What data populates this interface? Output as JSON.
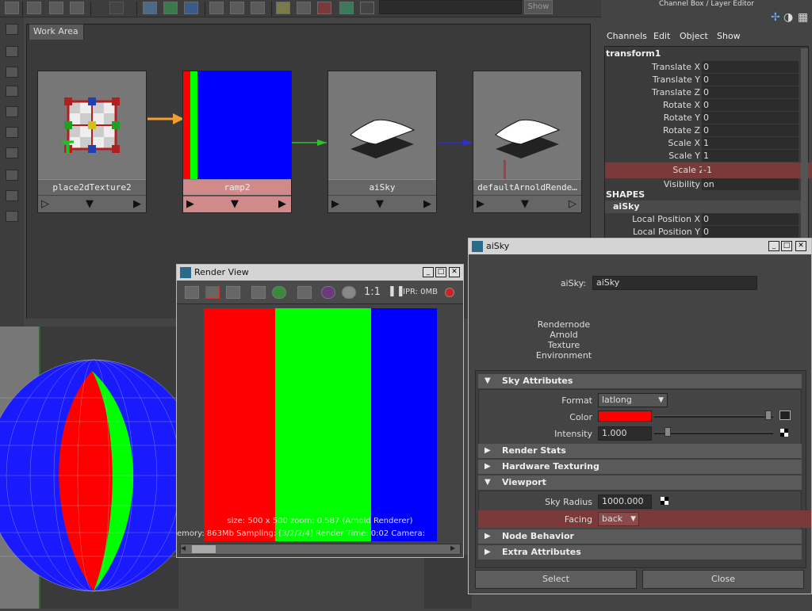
{
  "toolbar": {
    "show_label": "Show"
  },
  "workarea": {
    "tab_label": "Work Area"
  },
  "nodes": [
    {
      "label": "place2dTexture2"
    },
    {
      "label": "ramp2"
    },
    {
      "label": "aiSky"
    },
    {
      "label": "defaultArnoldRende…"
    }
  ],
  "channel_box": {
    "title": "Channel Box / Layer Editor",
    "menu": [
      "Channels",
      "Edit",
      "Object",
      "Show"
    ],
    "object": "transform1",
    "attrs": [
      {
        "name": "Translate X",
        "value": "0"
      },
      {
        "name": "Translate Y",
        "value": "0"
      },
      {
        "name": "Translate Z",
        "value": "0"
      },
      {
        "name": "Rotate X",
        "value": "0"
      },
      {
        "name": "Rotate Y",
        "value": "0"
      },
      {
        "name": "Rotate Z",
        "value": "0"
      },
      {
        "name": "Scale X",
        "value": "1"
      },
      {
        "name": "Scale Y",
        "value": "1"
      },
      {
        "name": "Scale Z",
        "value": "-1"
      },
      {
        "name": "Visibility",
        "value": "on"
      }
    ],
    "shapes_header": "SHAPES",
    "shape_name": "aiSky",
    "shape_attrs": [
      {
        "name": "Local Position X",
        "value": "0"
      },
      {
        "name": "Local Position Y",
        "value": "0"
      }
    ]
  },
  "render_view": {
    "title": "Render View",
    "ratio_label": "1:1",
    "ipr_label": "IPR: 0MB",
    "info_line1": "size: 500 x 500 zoom: 0.587     (Arnold Renderer)",
    "info_line2": "emory: 863Mb    Sampling: [3/2/2/4]    Render Time: 0:02    Camera:",
    "stripe_colors": [
      "#ff0000",
      "#00ff00",
      "#0000ff"
    ]
  },
  "attribute_editor": {
    "title": "aiSky",
    "name_label": "aiSky:",
    "name_value": "aiSky",
    "desc": [
      "Rendernode",
      "Arnold",
      "Texture",
      "Environment"
    ],
    "sky_section": "Sky Attributes",
    "format_label": "Format",
    "format_value": "latlong",
    "color_label": "Color",
    "color_value": "#ff0000",
    "intensity_label": "Intensity",
    "intensity_value": "1.000",
    "render_stats": "Render Stats",
    "hardware_texturing": "Hardware Texturing",
    "viewport_section": "Viewport",
    "sky_radius_label": "Sky Radius",
    "sky_radius_value": "1000.000",
    "facing_label": "Facing",
    "facing_value": "back",
    "node_behavior": "Node Behavior",
    "extra_attributes": "Extra Attributes",
    "select_label": "Select",
    "close_label": "Close"
  }
}
